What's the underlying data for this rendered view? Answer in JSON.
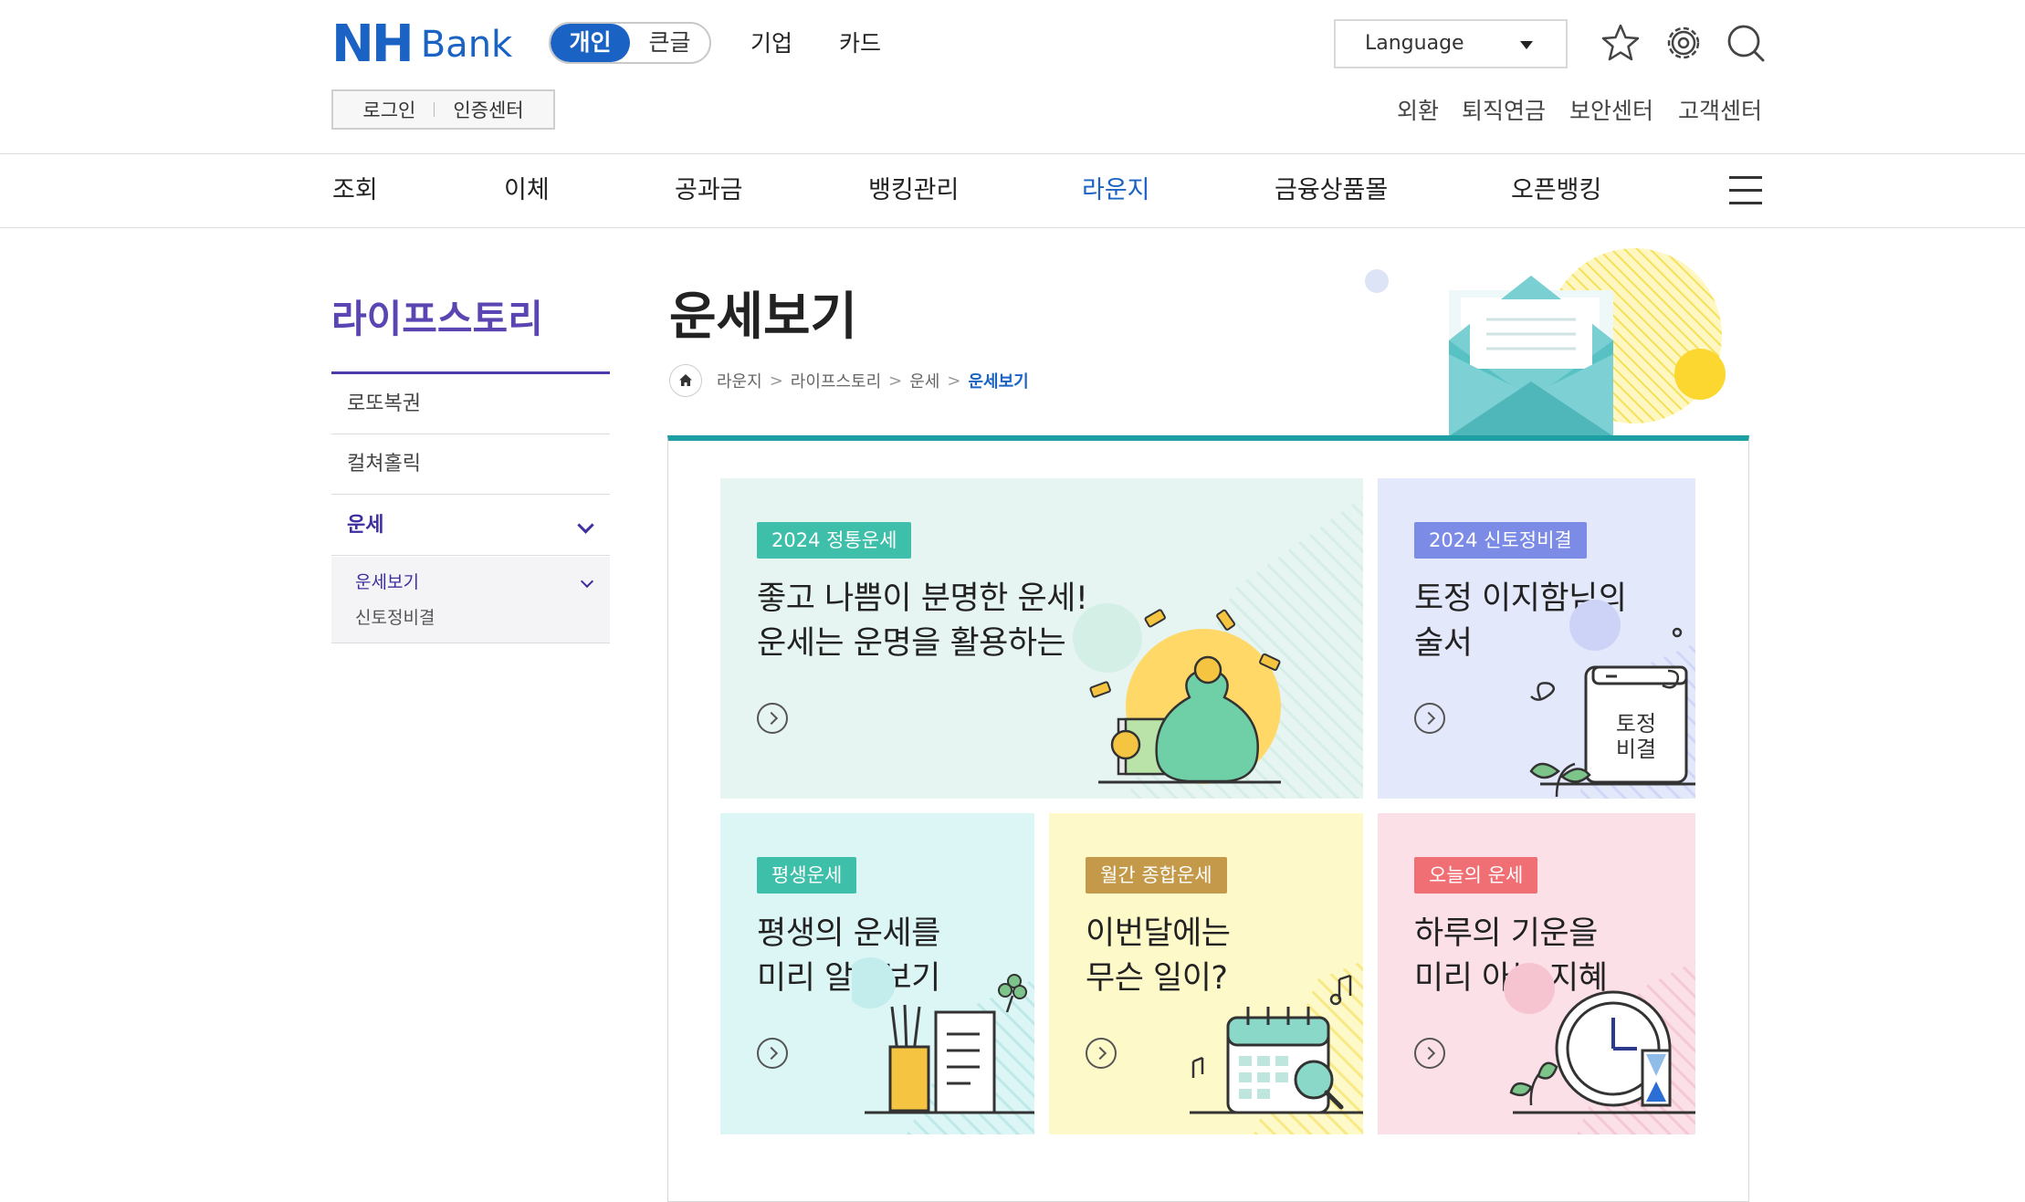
{
  "header": {
    "logo_text": "NH",
    "logo_sub": "Bank",
    "segment": {
      "active": "개인",
      "inactive": "큰글"
    },
    "links": [
      "기업",
      "카드"
    ],
    "language_label": "Language",
    "icons": [
      "star-icon",
      "gear-icon",
      "search-icon"
    ],
    "auth": {
      "login": "로그인",
      "cert": "인증센터"
    },
    "util_links": [
      "외환",
      "퇴직연금",
      "보안센터",
      "고객센터"
    ]
  },
  "gnb": {
    "items": [
      "조회",
      "이체",
      "공과금",
      "뱅킹관리",
      "라운지",
      "금융상품몰",
      "오픈뱅킹"
    ],
    "active": "라운지",
    "menu_icon": "hamburger-icon"
  },
  "sidebar": {
    "title": "라이프스토리",
    "items": [
      "로또복권",
      "컬쳐홀릭",
      "운세"
    ],
    "sub_items": [
      "운세보기",
      "신토정비결"
    ]
  },
  "page": {
    "title": "운세보기",
    "breadcrumb": [
      "라운지",
      "라이프스토리",
      "운세",
      "운세보기"
    ]
  },
  "cards": [
    {
      "tag": "2024 정통운세",
      "line1": "좋고 나쁨이 분명한 운세!",
      "line2": "운세는 운명을 활용하는 것",
      "bg": "#e6f5f1",
      "tag_color": "#3dbfa9",
      "illustration": "money-bag-icon"
    },
    {
      "tag": "2024 신토정비결",
      "line1": "토정 이지함님의",
      "line2": "술서",
      "bg": "#e4e8fb",
      "tag_color": "#7c8be6",
      "book_line1": "토정",
      "book_line2": "비결",
      "illustration": "book-icon"
    },
    {
      "tag": "평생운세",
      "line1": "평생의 운세를",
      "line2": "미리 알아보기",
      "bg": "#dcf5f5",
      "tag_color": "#3dbfa9",
      "illustration": "pencil-cup-icon"
    },
    {
      "tag": "월간 종합운세",
      "line1": "이번달에는",
      "line2": "무슨 일이?",
      "bg": "#fdf9c9",
      "tag_color": "#c49a4a",
      "illustration": "calendar-icon"
    },
    {
      "tag": "오늘의 운세",
      "line1": "하루의 기운을",
      "line2": "미리 아는 지혜",
      "bg": "#fbe0e8",
      "tag_color": "#ef6f74",
      "illustration": "clock-icon"
    }
  ]
}
